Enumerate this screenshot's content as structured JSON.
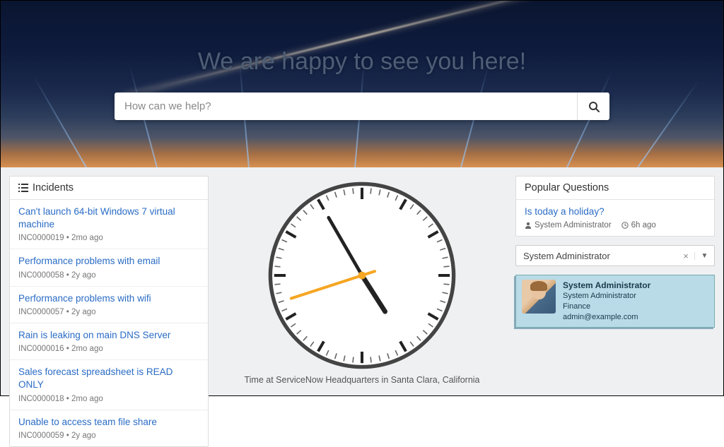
{
  "hero": {
    "title": "We are happy to see you here!",
    "search_placeholder": "How can we help?"
  },
  "incidents": {
    "header": "Incidents",
    "items": [
      {
        "title": "Can't launch 64-bit Windows 7 virtual machine",
        "id": "INC0000019",
        "age": "2mo ago"
      },
      {
        "title": "Performance problems with email",
        "id": "INC0000058",
        "age": "2y ago"
      },
      {
        "title": "Performance problems with wifi",
        "id": "INC0000057",
        "age": "2y ago"
      },
      {
        "title": "Rain is leaking on main DNS Server",
        "id": "INC0000016",
        "age": "2mo ago"
      },
      {
        "title": "Sales forecast spreadsheet is READ ONLY",
        "id": "INC0000018",
        "age": "2mo ago"
      },
      {
        "title": "Unable to access team file share",
        "id": "INC0000059",
        "age": "2y ago"
      }
    ]
  },
  "clock": {
    "caption": "Time at ServiceNow Headquarters in Santa Clara, California",
    "hour": 4,
    "minute": 55,
    "second": 42
  },
  "questions": {
    "header": "Popular Questions",
    "items": [
      {
        "title": "Is today a holiday?",
        "author": "System Administrator",
        "age": "6h ago"
      }
    ]
  },
  "user_select": {
    "value": "System Administrator"
  },
  "user_card": {
    "name": "System Administrator",
    "role": "System Administrator",
    "dept": "Finance",
    "email": "admin@example.com"
  }
}
